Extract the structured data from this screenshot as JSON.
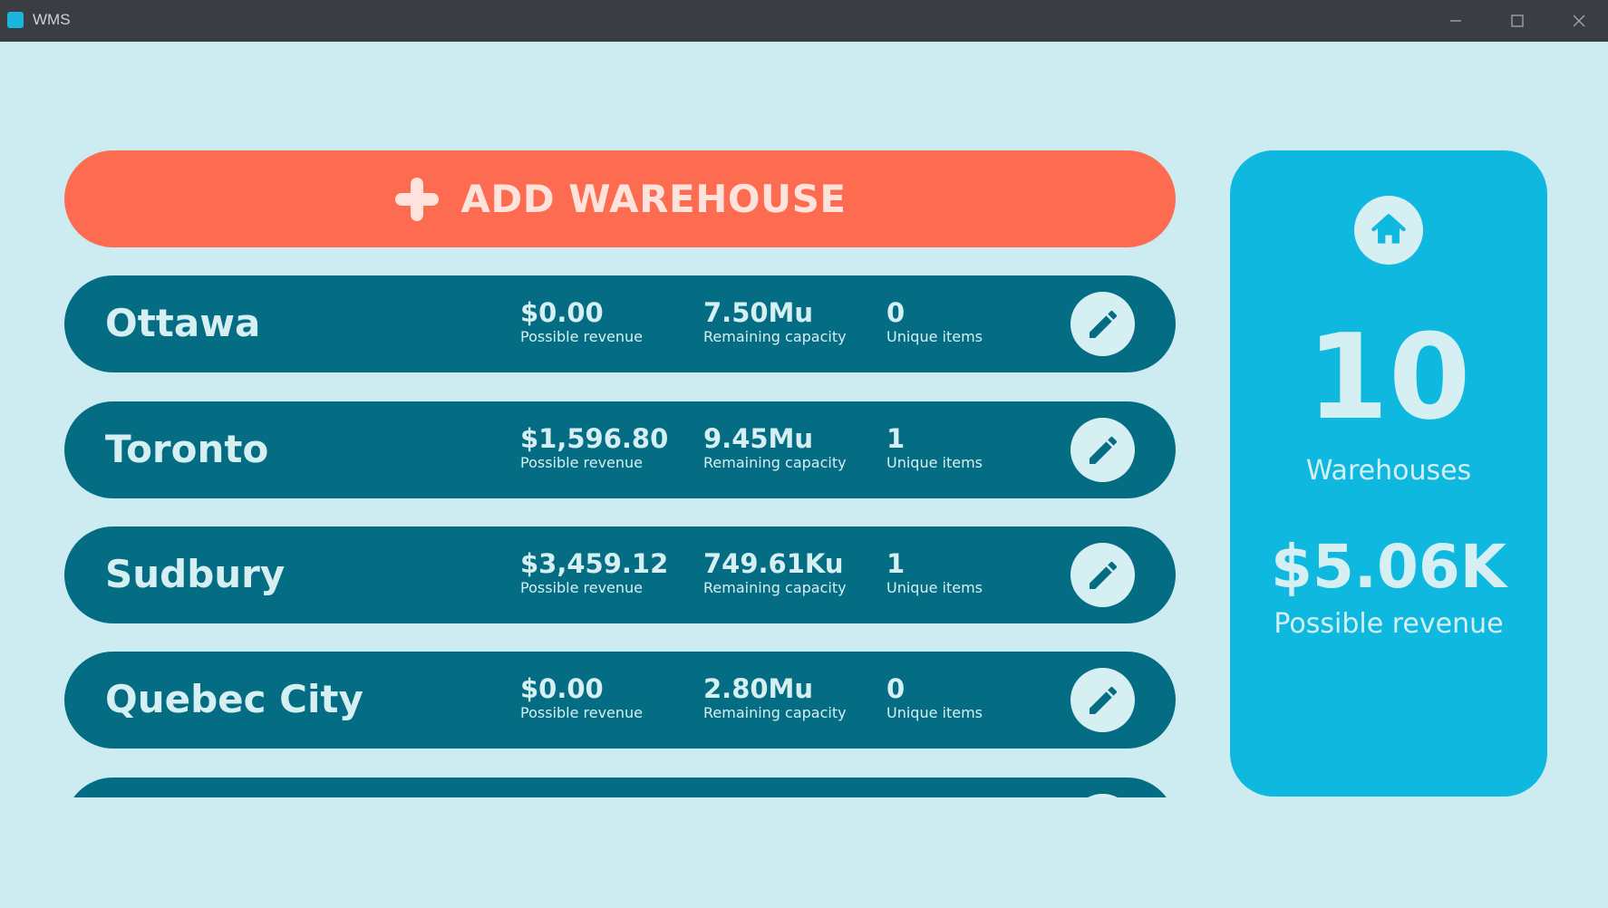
{
  "window": {
    "title": "WMS"
  },
  "add_button": {
    "label": "ADD WAREHOUSE"
  },
  "warehouses": [
    {
      "name": "Ottawa",
      "revenue": "$0.00",
      "revenue_label": "Possible revenue",
      "capacity": "7.50Mu",
      "capacity_label": "Remaining capacity",
      "items": "0",
      "items_label": "Unique items"
    },
    {
      "name": "Toronto",
      "revenue": "$1,596.80",
      "revenue_label": "Possible revenue",
      "capacity": "9.45Mu",
      "capacity_label": "Remaining capacity",
      "items": "1",
      "items_label": "Unique items"
    },
    {
      "name": "Sudbury",
      "revenue": "$3,459.12",
      "revenue_label": "Possible revenue",
      "capacity": "749.61Ku",
      "capacity_label": "Remaining capacity",
      "items": "1",
      "items_label": "Unique items"
    },
    {
      "name": "Quebec City",
      "revenue": "$0.00",
      "revenue_label": "Possible revenue",
      "capacity": "2.80Mu",
      "capacity_label": "Remaining capacity",
      "items": "0",
      "items_label": "Unique items"
    }
  ],
  "summary": {
    "icon": "home-icon",
    "count": "10",
    "count_label": "Warehouses",
    "revenue": "$5.06K",
    "revenue_label": "Possible revenue"
  },
  "colors": {
    "background": "#cdecf1",
    "accent": "#fd6b50",
    "row": "#046d83",
    "panel": "#0eb8df",
    "text_light": "#d6eff3"
  }
}
